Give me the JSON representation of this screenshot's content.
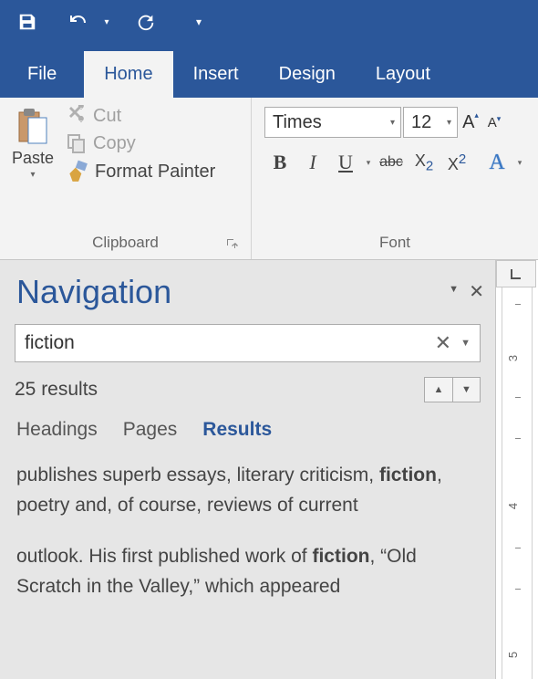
{
  "qat": {
    "save": "save",
    "undo": "undo",
    "redo": "redo"
  },
  "tabs": {
    "file": "File",
    "home": "Home",
    "insert": "Insert",
    "design": "Design",
    "layout": "Layout"
  },
  "ribbon": {
    "clipboard": {
      "paste": "Paste",
      "cut": "Cut",
      "copy": "Copy",
      "format_painter": "Format Painter",
      "group_label": "Clipboard"
    },
    "font": {
      "name": "Times",
      "size": "12",
      "group_label": "Font"
    }
  },
  "navigation": {
    "title": "Navigation",
    "search_value": "fiction",
    "results_count": "25 results",
    "tabs": {
      "headings": "Headings",
      "pages": "Pages",
      "results": "Results"
    },
    "items": [
      {
        "pre": "publishes superb essays, literary criticism, ",
        "hl": "fiction",
        "post": ", poetry and, of course, reviews of current"
      },
      {
        "pre": "outlook.  His first published work of ",
        "hl": "fiction",
        "post": ", “Old Scratch in the Valley,” which appeared"
      }
    ]
  },
  "ruler": {
    "marks": [
      "3",
      "4",
      "5"
    ]
  }
}
